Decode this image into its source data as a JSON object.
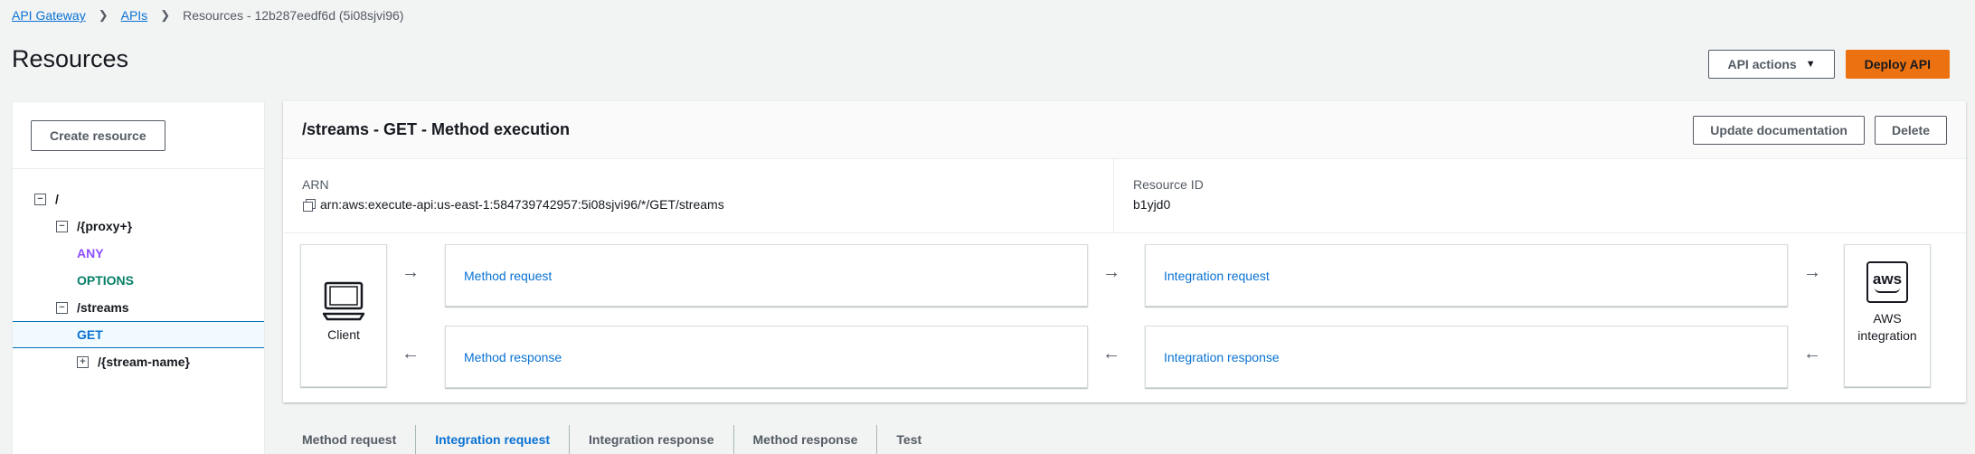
{
  "breadcrumb": {
    "items": [
      "API Gateway",
      "APIs"
    ],
    "current": "Resources - 12b287eedf6d (5i08sjvi96)"
  },
  "page": {
    "title": "Resources"
  },
  "header_actions": {
    "api_actions_label": "API actions",
    "deploy_label": "Deploy API"
  },
  "left": {
    "create_resource_label": "Create resource",
    "tree": [
      {
        "label": "/",
        "type": "resource",
        "icon": "collapse-icon"
      },
      {
        "label": "/{proxy+}",
        "type": "resource",
        "icon": "collapse-icon"
      },
      {
        "label": "ANY",
        "type": "method"
      },
      {
        "label": "OPTIONS",
        "type": "method"
      },
      {
        "label": "/streams",
        "type": "resource",
        "icon": "collapse-icon"
      },
      {
        "label": "GET",
        "type": "method",
        "selected": true
      },
      {
        "label": "/{stream-name}",
        "type": "resource",
        "icon": "expand-icon"
      }
    ]
  },
  "main": {
    "title": "/streams - GET - Method execution",
    "update_doc_label": "Update documentation",
    "delete_label": "Delete",
    "arn_label": "ARN",
    "arn_value": "arn:aws:execute-api:us-east-1:584739742957:5i08sjvi96/*/GET/streams",
    "resource_id_label": "Resource ID",
    "resource_id_value": "b1yjd0"
  },
  "flow": {
    "client_label": "Client",
    "method_request": "Method request",
    "integration_request": "Integration request",
    "method_response": "Method response",
    "integration_response": "Integration response",
    "aws_logo_text": "aws",
    "aws_label": "AWS integration"
  },
  "tabs": [
    {
      "label": "Method request",
      "active": false
    },
    {
      "label": "Integration request",
      "active": true
    },
    {
      "label": "Integration response",
      "active": false
    },
    {
      "label": "Method response",
      "active": false
    },
    {
      "label": "Test",
      "active": false
    }
  ],
  "colors": {
    "accent": "#0972d3",
    "primary_button": "#ec7211",
    "any_method": "#8c4fff",
    "options_method": "#067f68"
  }
}
